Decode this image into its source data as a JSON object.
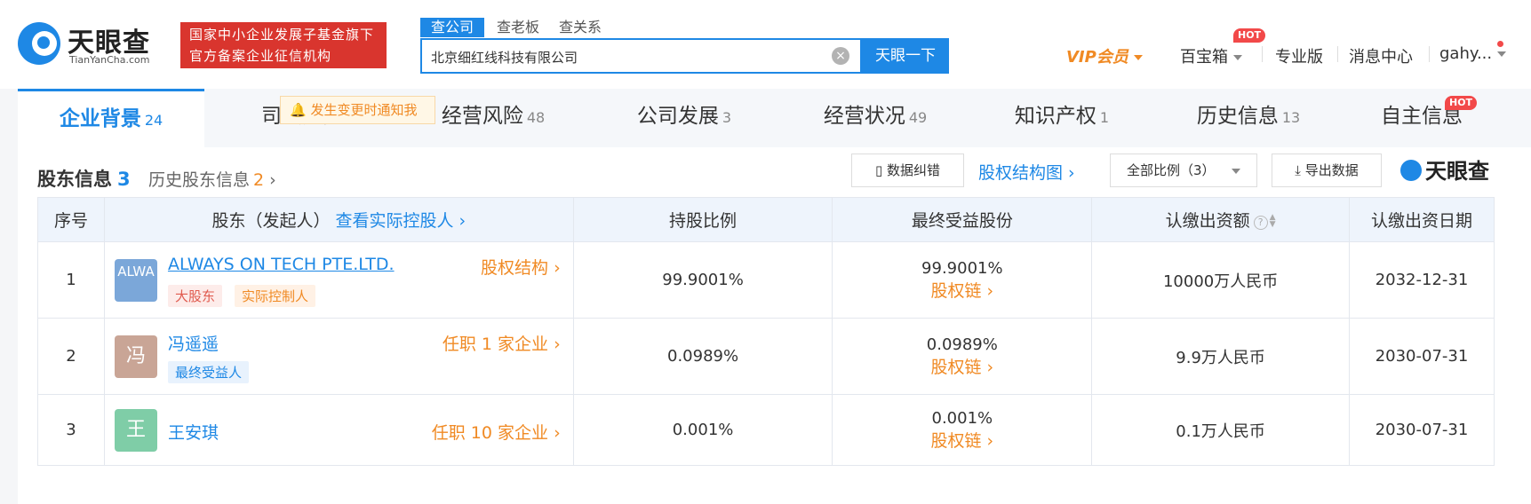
{
  "brand": {
    "name_cn": "天眼查",
    "name_en": "TianYanCha.com",
    "slogan_line1": "国家中小企业发展子基金旗下",
    "slogan_line2": "官方备案企业征信机构"
  },
  "search": {
    "tabs": [
      "查公司",
      "查老板",
      "查关系"
    ],
    "value": "北京细红线科技有限公司",
    "button": "天眼一下"
  },
  "nav": {
    "vip": "VIP会员",
    "treasure": "百宝箱",
    "hot": "HOT",
    "pro": "专业版",
    "messages": "消息中心",
    "user": "gahy..."
  },
  "tabs": [
    {
      "label": "企业背景",
      "count": "24"
    },
    {
      "label": "司法风险",
      "count": ""
    },
    {
      "label": "经营风险",
      "count": "48"
    },
    {
      "label": "公司发展",
      "count": "3"
    },
    {
      "label": "经营状况",
      "count": "49"
    },
    {
      "label": "知识产权",
      "count": "1"
    },
    {
      "label": "历史信息",
      "count": "13"
    },
    {
      "label": "自主信息",
      "count": ""
    }
  ],
  "section": {
    "title": "股东信息",
    "count": "3",
    "history_label": "历史股东信息",
    "history_count": "2",
    "notify": "发生变更时通知我",
    "correct_btn": "数据纠错",
    "structure_link": "股权结构图",
    "ratio_select": "全部比例（3）",
    "export_btn": "导出数据",
    "watermark": "天眼查"
  },
  "table": {
    "headers": {
      "index": "序号",
      "shareholder": "股东（发起人）",
      "actual_controller_link": "查看实际控股人",
      "ratio": "持股比例",
      "final_benefit": "最终受益股份",
      "subscribed": "认缴出资额",
      "date": "认缴出资日期"
    },
    "rows": [
      {
        "index": "1",
        "avatar": "ALWA",
        "name": "ALWAYS ON TECH PTE.LTD.",
        "tags": [
          "大股东",
          "实际控制人"
        ],
        "right_link": "股权结构",
        "ratio": "99.9001%",
        "final": "99.9001%",
        "chain": "股权链",
        "amount": "10000万人民币",
        "date": "2032-12-31"
      },
      {
        "index": "2",
        "avatar": "冯",
        "name": "冯遥遥",
        "tags": [
          "最终受益人"
        ],
        "right_link": "任职 1 家企业",
        "ratio": "0.0989%",
        "final": "0.0989%",
        "chain": "股权链",
        "amount": "9.9万人民币",
        "date": "2030-07-31"
      },
      {
        "index": "3",
        "avatar": "王",
        "name": "王安琪",
        "tags": [],
        "right_link": "任职 10 家企业",
        "ratio": "0.001%",
        "final": "0.001%",
        "chain": "股权链",
        "amount": "0.1万人民币",
        "date": "2030-07-31"
      }
    ]
  },
  "colors": {
    "accent": "#1e88e5",
    "orange": "#f08a24",
    "red": "#d9352e"
  }
}
